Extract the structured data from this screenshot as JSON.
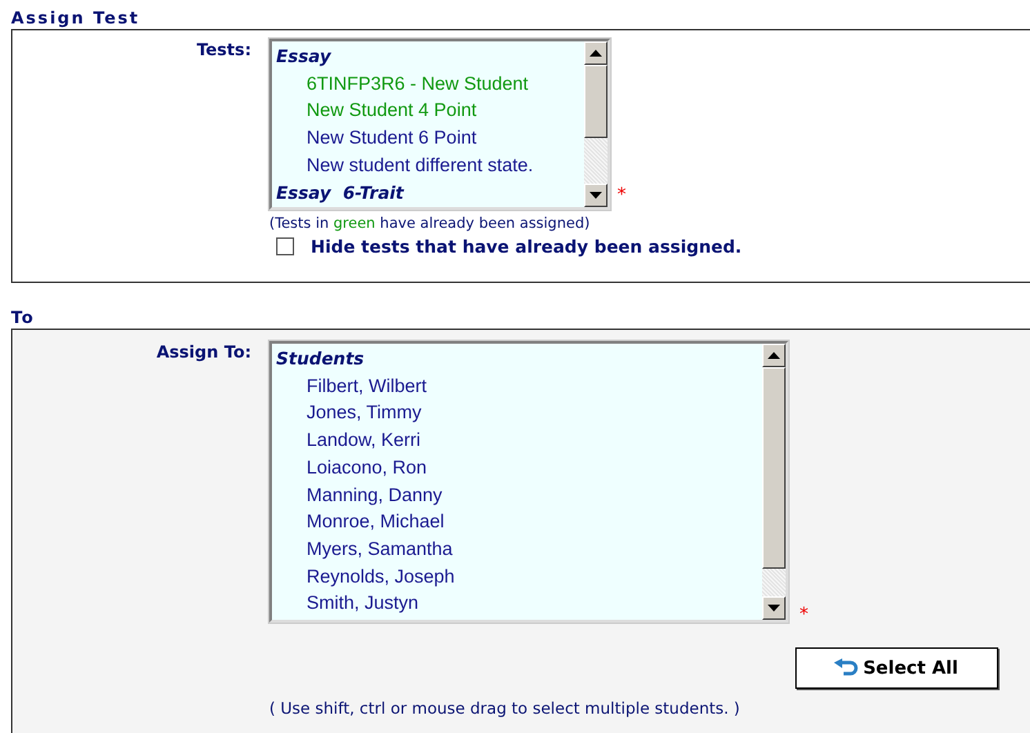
{
  "assign_test": {
    "heading": "Assign Test",
    "tests_label": "Tests:",
    "tests": [
      {
        "kind": "group",
        "text": "Essay"
      },
      {
        "kind": "option",
        "text": "6TINFP3R6 - New Student",
        "assigned": true
      },
      {
        "kind": "option",
        "text": "New Student 4 Point",
        "assigned": true
      },
      {
        "kind": "option",
        "text": "New Student 6 Point",
        "assigned": false
      },
      {
        "kind": "option",
        "text": "New student different state.",
        "assigned": false
      },
      {
        "kind": "group",
        "text": "Essay  6-Trait"
      }
    ],
    "required_mark": "*",
    "note": {
      "before": "(Tests in ",
      "highlight": "green",
      "after": " have already been assigned)"
    },
    "hide_assigned": {
      "label": "Hide tests that have already been assigned.",
      "checked": false
    }
  },
  "to": {
    "heading": "To",
    "assign_label": "Assign To:",
    "students": [
      {
        "kind": "group",
        "text": "Students"
      },
      {
        "kind": "option",
        "text": "Filbert, Wilbert"
      },
      {
        "kind": "option",
        "text": "Jones, Timmy"
      },
      {
        "kind": "option",
        "text": "Landow, Kerri"
      },
      {
        "kind": "option",
        "text": "Loiacono, Ron"
      },
      {
        "kind": "option",
        "text": "Manning, Danny"
      },
      {
        "kind": "option",
        "text": "Monroe, Michael"
      },
      {
        "kind": "option",
        "text": "Myers, Samantha"
      },
      {
        "kind": "option",
        "text": "Reynolds, Joseph"
      },
      {
        "kind": "option",
        "text": "Smith, Justyn"
      }
    ],
    "required_mark": "*",
    "select_all": "Select All",
    "hint": "( Use shift, ctrl or mouse drag to select multiple students. )"
  }
}
